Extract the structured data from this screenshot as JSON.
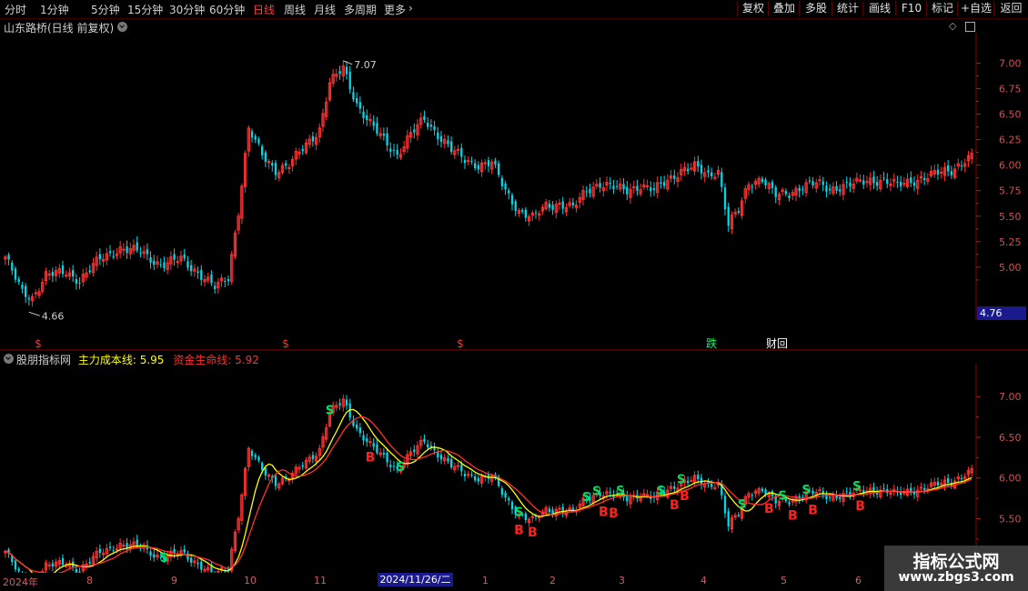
{
  "toolbar": {
    "periods": [
      "分时",
      "1分钟",
      "5分钟",
      "15分钟",
      "30分钟",
      "60分钟",
      "日线",
      "周线",
      "月线",
      "多周期",
      "更多"
    ],
    "active_period": "日线",
    "right_buttons": [
      "复权",
      "叠加",
      "多股",
      "统计",
      "画线",
      "F10",
      "标记",
      "+自选",
      "返回"
    ]
  },
  "main_title": "山东路桥(日线 前复权)",
  "indicator": {
    "name": "股朋指标网",
    "line1_label": "主力成本线:",
    "line1_value": "5.95",
    "line2_label": "资金生命线:",
    "line2_value": "5.92"
  },
  "price_tag": "4.76",
  "date_highlight": "2024/11/26/二",
  "watermark": {
    "line1": "指标公式网",
    "line2": "www.zbgs3.com"
  },
  "colors": {
    "up": "#ff3232",
    "down": "#00d8e8",
    "line_cost": "#ffff00",
    "line_life": "#ff3030"
  },
  "chart_data": [
    {
      "type": "candlestick",
      "title": "山东路桥(日线 前复权)",
      "ylim": [
        4.58,
        7.28
      ],
      "yticks": [
        "7.00",
        "6.75",
        "6.50",
        "6.25",
        "6.00",
        "5.75",
        "5.50",
        "5.25",
        "5.00"
      ],
      "x_labels": [
        "2024年",
        "8",
        "9",
        "10",
        "11",
        "2024/11/26/二",
        "1",
        "2",
        "3",
        "4",
        "5",
        "6"
      ],
      "high_label": "7.07",
      "low_label": "4.66",
      "markers": [
        {
          "text": "$",
          "month": "7",
          "color": "#ff3232"
        },
        {
          "text": "$",
          "month": "10",
          "color": "#ff3232"
        },
        {
          "text": "$",
          "month": "11",
          "color": "#ff3232"
        },
        {
          "text": "跌",
          "month": "3",
          "color": "#00ff66"
        },
        {
          "text": "财回",
          "month": "4",
          "color": "#ffffff"
        }
      ],
      "close_path": [
        {
          "day": 0,
          "close": 5.1
        },
        {
          "day": 5,
          "close": 4.75
        },
        {
          "day": 8,
          "close": 4.7
        },
        {
          "day": 12,
          "close": 4.92
        },
        {
          "day": 18,
          "close": 4.95
        },
        {
          "day": 22,
          "close": 4.87
        },
        {
          "day": 28,
          "close": 5.08
        },
        {
          "day": 34,
          "close": 5.18
        },
        {
          "day": 40,
          "close": 5.15
        },
        {
          "day": 46,
          "close": 5.02
        },
        {
          "day": 52,
          "close": 5.08
        },
        {
          "day": 58,
          "close": 4.92
        },
        {
          "day": 62,
          "close": 4.8
        },
        {
          "day": 66,
          "close": 4.9
        },
        {
          "day": 69,
          "close": 5.55
        },
        {
          "day": 72,
          "close": 6.35
        },
        {
          "day": 76,
          "close": 6.1
        },
        {
          "day": 80,
          "close": 5.95
        },
        {
          "day": 84,
          "close": 6.0
        },
        {
          "day": 89,
          "close": 6.2
        },
        {
          "day": 93,
          "close": 6.35
        },
        {
          "day": 96,
          "close": 6.8
        },
        {
          "day": 100,
          "close": 6.95
        },
        {
          "day": 104,
          "close": 6.6
        },
        {
          "day": 108,
          "close": 6.4
        },
        {
          "day": 112,
          "close": 6.25
        },
        {
          "day": 116,
          "close": 6.1
        },
        {
          "day": 120,
          "close": 6.3
        },
        {
          "day": 124,
          "close": 6.45
        },
        {
          "day": 128,
          "close": 6.3
        },
        {
          "day": 132,
          "close": 6.15
        },
        {
          "day": 136,
          "close": 6.05
        },
        {
          "day": 140,
          "close": 6.0
        },
        {
          "day": 144,
          "close": 6.02
        },
        {
          "day": 148,
          "close": 5.75
        },
        {
          "day": 152,
          "close": 5.55
        },
        {
          "day": 156,
          "close": 5.48
        },
        {
          "day": 160,
          "close": 5.6
        },
        {
          "day": 164,
          "close": 5.62
        },
        {
          "day": 168,
          "close": 5.58
        },
        {
          "day": 172,
          "close": 5.75
        },
        {
          "day": 176,
          "close": 5.82
        },
        {
          "day": 180,
          "close": 5.78
        },
        {
          "day": 184,
          "close": 5.75
        },
        {
          "day": 188,
          "close": 5.8
        },
        {
          "day": 192,
          "close": 5.75
        },
        {
          "day": 196,
          "close": 5.85
        },
        {
          "day": 200,
          "close": 5.95
        },
        {
          "day": 204,
          "close": 5.98
        },
        {
          "day": 208,
          "close": 5.9
        },
        {
          "day": 211,
          "close": 5.95
        },
        {
          "day": 214,
          "close": 5.42
        },
        {
          "day": 217,
          "close": 5.55
        },
        {
          "day": 220,
          "close": 5.82
        },
        {
          "day": 224,
          "close": 5.87
        },
        {
          "day": 228,
          "close": 5.7
        },
        {
          "day": 232,
          "close": 5.72
        },
        {
          "day": 236,
          "close": 5.8
        },
        {
          "day": 240,
          "close": 5.82
        },
        {
          "day": 244,
          "close": 5.76
        },
        {
          "day": 248,
          "close": 5.8
        },
        {
          "day": 252,
          "close": 5.82
        },
        {
          "day": 256,
          "close": 5.85
        },
        {
          "day": 260,
          "close": 5.85
        },
        {
          "day": 264,
          "close": 5.8
        },
        {
          "day": 268,
          "close": 5.84
        },
        {
          "day": 272,
          "close": 5.88
        },
        {
          "day": 276,
          "close": 5.92
        },
        {
          "day": 280,
          "close": 5.95
        },
        {
          "day": 284,
          "close": 6.05
        },
        {
          "day": 286,
          "close": 6.08
        }
      ]
    },
    {
      "type": "line",
      "title": "股朋指标网",
      "ylim": [
        4.88,
        7.36
      ],
      "yticks": [
        "7.00",
        "6.50",
        "6.00",
        "5.50",
        "5.00"
      ],
      "series": [
        {
          "name": "主力成本线",
          "last": 5.95,
          "color": "#ffff00"
        },
        {
          "name": "资金生命线",
          "last": 5.92,
          "color": "#ff3030"
        }
      ],
      "signals": [
        {
          "text": "B",
          "month": "7"
        },
        {
          "text": "S",
          "month": "8"
        },
        {
          "text": "B",
          "month": "9"
        },
        {
          "text": "S",
          "month": "11"
        },
        {
          "text": "B",
          "month": "11"
        },
        {
          "text": "S",
          "month": "11"
        },
        {
          "text": "S",
          "month": "2"
        },
        {
          "text": "B",
          "month": "2"
        },
        {
          "text": "B",
          "month": "2"
        },
        {
          "text": "S",
          "month": "3"
        },
        {
          "text": "S",
          "month": "3"
        },
        {
          "text": "B",
          "month": "3"
        },
        {
          "text": "S",
          "month": "3"
        },
        {
          "text": "B",
          "month": "3"
        },
        {
          "text": "S",
          "month": "4"
        },
        {
          "text": "S",
          "month": "4"
        },
        {
          "text": "B",
          "month": "4"
        },
        {
          "text": "B",
          "month": "4"
        },
        {
          "text": "S",
          "month": "5"
        },
        {
          "text": "B",
          "month": "5"
        },
        {
          "text": "S",
          "month": "5"
        },
        {
          "text": "B",
          "month": "5"
        },
        {
          "text": "S",
          "month": "5"
        },
        {
          "text": "B",
          "month": "5"
        },
        {
          "text": "S",
          "month": "6"
        },
        {
          "text": "B",
          "month": "6"
        }
      ]
    }
  ]
}
